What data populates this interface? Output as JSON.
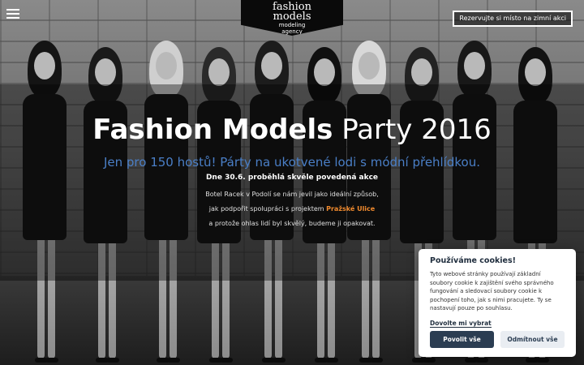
{
  "header": {
    "logo": {
      "line1": "fashion",
      "line2": "models",
      "line3": "modeling",
      "line4": "agency"
    },
    "reserve_button": "Rezervujte si místo na zimní akci"
  },
  "hero": {
    "title_bold": "Fashion Models",
    "title_light": "Party 2016",
    "subtitle": "Jen pro 150 hostů! Párty na ukotvené lodi s módní přehlídkou.",
    "intro": "Dne 30.6. proběhlá skvěle povedená akce",
    "line1": "Botel Racek v Podolí se nám jevil jako ideální způsob,",
    "line2_prefix": "jak podpořit  spolupráci s projektem",
    "line2_highlight": "Pražské Ulice",
    "line3": "a  protože ohlas lidí byl skvělý, budeme ji opakovat."
  },
  "cookie_banner": {
    "title": "Používáme cookies!",
    "text": "Tyto webové stránky používají základní soubory cookie k zajištění svého správného fungování a sledovací soubory cookie k pochopení toho, jak s nimi pracujete. Ty se nastavují pouze po souhlasu.",
    "allow_link": "Dovolte mi vybrat",
    "accept_button": "Povolit vše",
    "reject_button": "Odmítnout vše"
  },
  "colors": {
    "subtitle": "#4a7fc7",
    "highlight": "#f08a2e",
    "cookie_primary": "#2b3d52"
  }
}
